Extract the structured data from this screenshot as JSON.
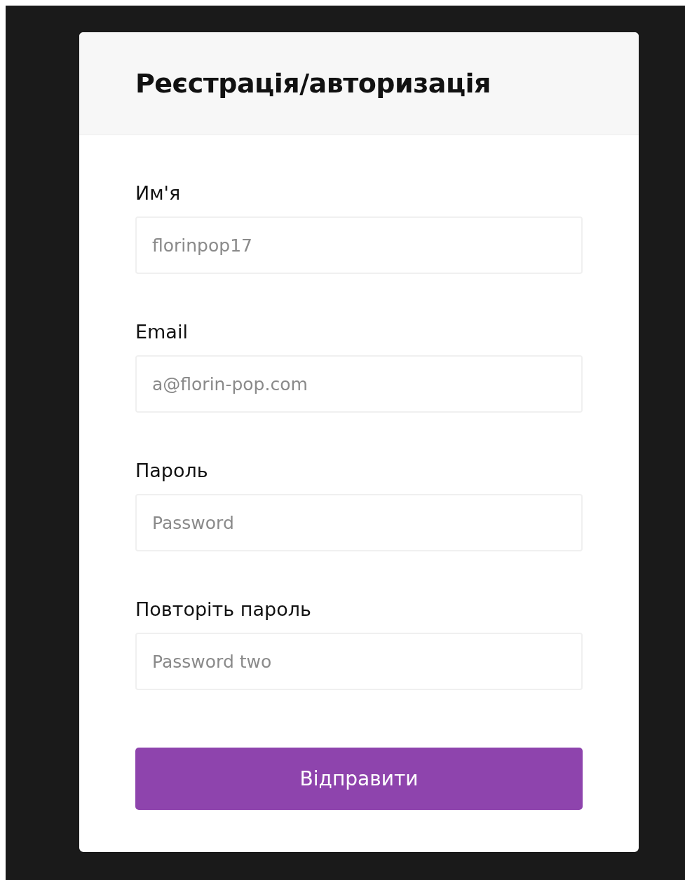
{
  "title": "Реєстрація/авторизація",
  "fields": [
    {
      "label": "Им'я",
      "placeholder": "florinpop17"
    },
    {
      "label": "Email",
      "placeholder": "a@florin-pop.com"
    },
    {
      "label": "Пароль",
      "placeholder": "Password"
    },
    {
      "label": "Повторіть пароль",
      "placeholder": "Password two"
    }
  ],
  "submit_button": "Відправити"
}
